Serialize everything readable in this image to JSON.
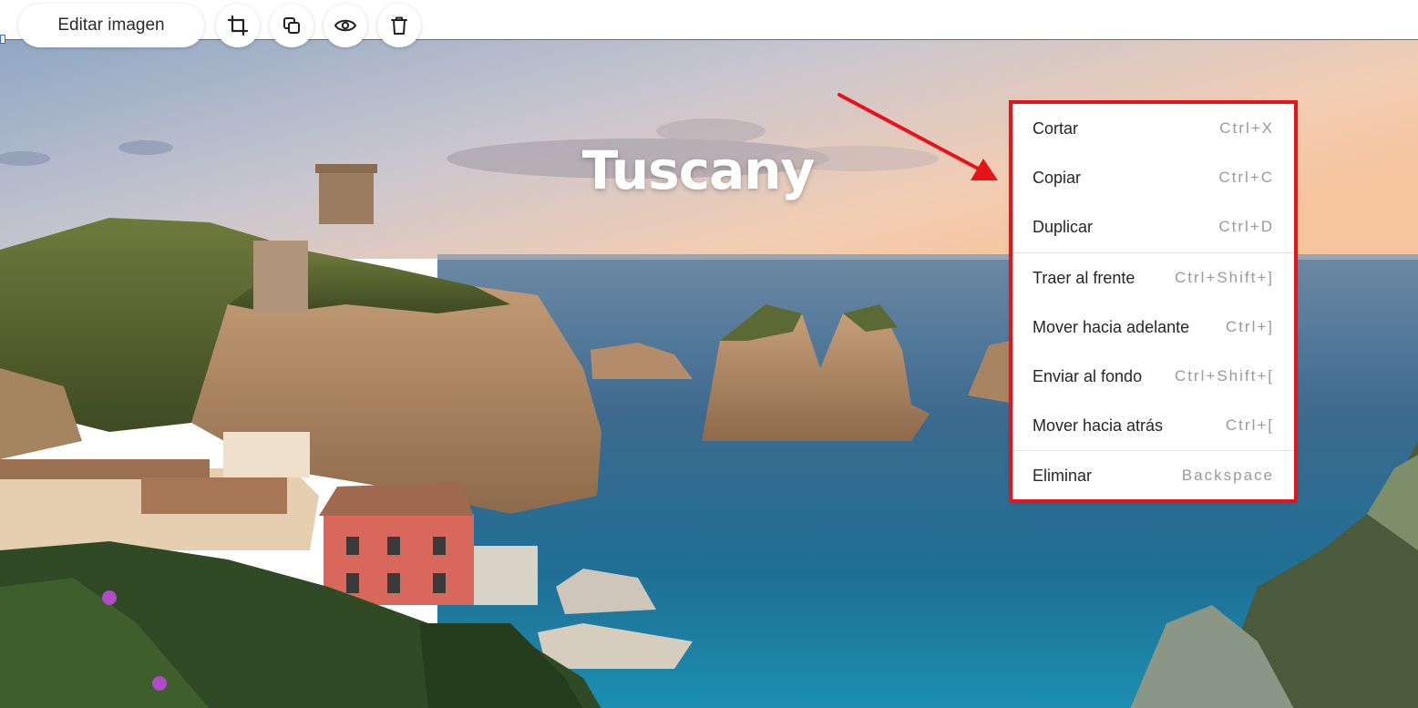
{
  "toolbar": {
    "edit_image_label": "Editar imagen",
    "icons": [
      "crop-icon",
      "duplicate-icon",
      "eye-icon",
      "trash-icon"
    ]
  },
  "hero": {
    "title": "Tuscany"
  },
  "context_menu": {
    "items": [
      {
        "label": "Cortar",
        "shortcut": "Ctrl+X"
      },
      {
        "label": "Copiar",
        "shortcut": "Ctrl+C"
      },
      {
        "label": "Duplicar",
        "shortcut": "Ctrl+D"
      },
      {
        "label": "Traer al frente",
        "shortcut": "Ctrl+Shift+]"
      },
      {
        "label": "Mover hacia adelante",
        "shortcut": "Ctrl+]"
      },
      {
        "label": "Enviar al fondo",
        "shortcut": "Ctrl+Shift+["
      },
      {
        "label": "Mover hacia atrás",
        "shortcut": "Ctrl+["
      },
      {
        "label": "Eliminar",
        "shortcut": "Backspace"
      }
    ]
  },
  "colors": {
    "highlight_border": "#e8121a",
    "selection_outline": "#3b6fd4",
    "arrow": "#e8121a"
  }
}
